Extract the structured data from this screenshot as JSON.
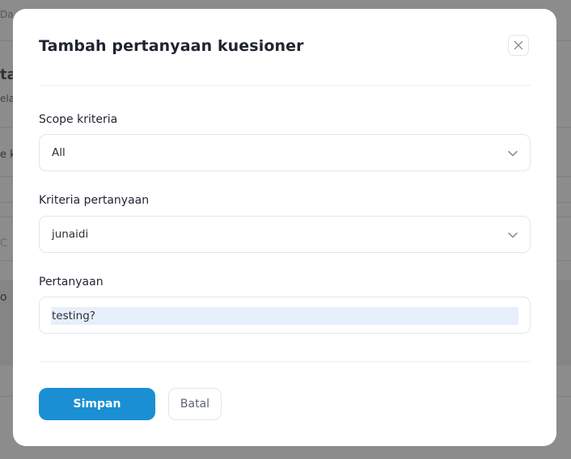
{
  "background": {
    "fragments": [
      "Das",
      "ta",
      "ela",
      "e k",
      "C",
      "o"
    ]
  },
  "modal": {
    "title": "Tambah pertanyaan kuesioner",
    "close_icon": "close-icon",
    "fields": {
      "scope": {
        "label": "Scope kriteria",
        "value": "All"
      },
      "kriteria": {
        "label": "Kriteria pertanyaan",
        "value": "junaidi"
      },
      "pertanyaan": {
        "label": "Pertanyaan",
        "value": "testing?"
      }
    },
    "buttons": {
      "save_label": "Simpan",
      "cancel_label": "Batal"
    }
  },
  "colors": {
    "primary": "#1a8fd4",
    "overlay": "#8c8c8c"
  }
}
